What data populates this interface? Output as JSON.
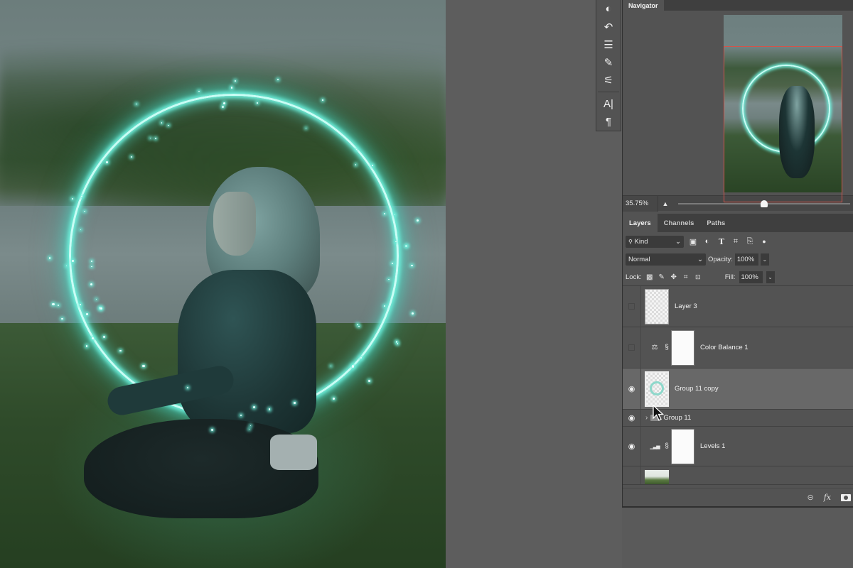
{
  "canvas": {
    "subject": "woman meditating on grass inside glowing teal ring",
    "ring_color": "#6ff0dc"
  },
  "toolstrip": {
    "tools": [
      {
        "name": "adjustments-icon",
        "glyph": "◐"
      },
      {
        "name": "history-icon",
        "glyph": "↶"
      },
      {
        "name": "properties-icon",
        "glyph": "☰"
      },
      {
        "name": "brush-settings-icon",
        "glyph": "✎"
      },
      {
        "name": "tool-presets-icon",
        "glyph": "⚟"
      },
      {
        "name": "character-icon",
        "glyph": "A|"
      },
      {
        "name": "paragraph-icon",
        "glyph": "¶"
      }
    ]
  },
  "navigator": {
    "tab": "Navigator",
    "zoom": "35.75%",
    "zoom_slider_fraction": 0.5,
    "viewbox_color": "#d2544a"
  },
  "layers_panel": {
    "tabs": [
      "Layers",
      "Channels",
      "Paths"
    ],
    "active_tab": "Layers",
    "filter": {
      "label": "Kind",
      "chevron": "⌄"
    },
    "filter_icons": [
      {
        "name": "pixel-filter-icon",
        "glyph": "▣"
      },
      {
        "name": "adjustment-filter-icon",
        "glyph": "◐"
      },
      {
        "name": "type-filter-icon",
        "glyph": "T"
      },
      {
        "name": "shape-filter-icon",
        "glyph": "⌗"
      },
      {
        "name": "smart-object-filter-icon",
        "glyph": "⎘"
      },
      {
        "name": "filter-toggle-icon",
        "glyph": "●"
      }
    ],
    "blend_mode": "Normal",
    "opacity_label": "Opacity:",
    "opacity": "100%",
    "lock_label": "Lock:",
    "lock_icons": [
      {
        "name": "lock-transparent-icon",
        "glyph": "▩"
      },
      {
        "name": "lock-pixels-icon",
        "glyph": "✎"
      },
      {
        "name": "lock-position-icon",
        "glyph": "✥"
      },
      {
        "name": "lock-artboard-icon",
        "glyph": "⌗"
      },
      {
        "name": "lock-all-icon",
        "glyph": "🔒"
      }
    ],
    "fill_label": "Fill:",
    "fill": "100%",
    "layers": [
      {
        "name": "Layer 3",
        "visible": false,
        "type": "pixel"
      },
      {
        "name": "Color Balance 1",
        "visible": false,
        "type": "adjustment",
        "adj_glyph": "⚖"
      },
      {
        "name": "Group 11 copy",
        "visible": true,
        "type": "pixel",
        "selected": true
      },
      {
        "name": "Group 11",
        "visible": true,
        "type": "group"
      },
      {
        "name": "Levels 1",
        "visible": true,
        "type": "adjustment",
        "adj_glyph": "▁▃▅"
      },
      {
        "name": "",
        "visible": false,
        "type": "photo"
      }
    ],
    "footer_icons": [
      {
        "name": "link-layers-icon",
        "glyph": "⊖"
      },
      {
        "name": "fx-icon",
        "glyph": "fx"
      },
      {
        "name": "add-mask-icon",
        "glyph": ""
      }
    ]
  },
  "glyphs": {
    "eye": "👁",
    "chain": "⛓",
    "chevron_right": "›",
    "chevron_down": "⌄",
    "search": "🔍"
  }
}
